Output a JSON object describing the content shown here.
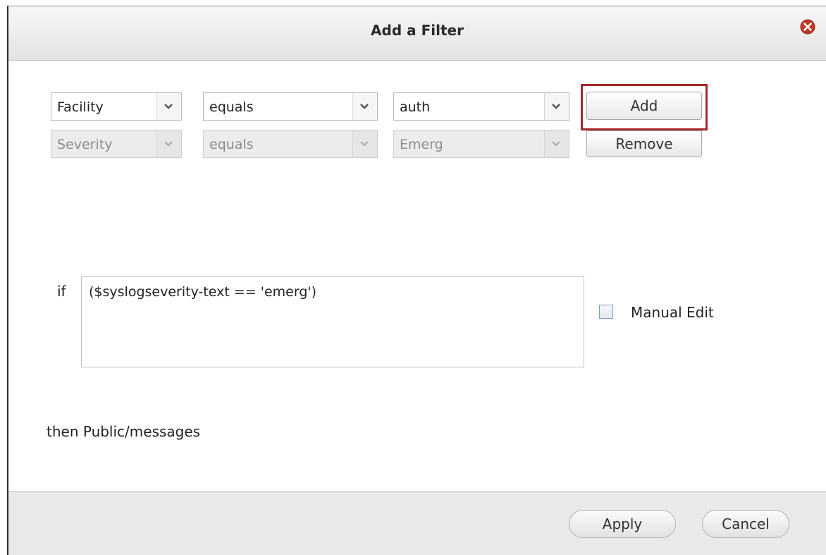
{
  "dialog": {
    "title": "Add a Filter"
  },
  "filter_rows": [
    {
      "field": "Facility",
      "operator": "equals",
      "value": "auth",
      "enabled": true
    },
    {
      "field": "Severity",
      "operator": "equals",
      "value": "Emerg",
      "enabled": false
    }
  ],
  "buttons": {
    "add_label": "Add",
    "remove_label": "Remove",
    "apply_label": "Apply",
    "cancel_label": "Cancel"
  },
  "condition": {
    "if_label": "if",
    "expression": "($syslogseverity-text == 'emerg')",
    "manual_edit_label": "Manual Edit",
    "manual_edit_checked": false
  },
  "action": {
    "then_text": "then Public/messages"
  },
  "colors": {
    "highlight": "#a3282f",
    "close_icon": "#c0392b"
  },
  "icons": {
    "close": "close-icon",
    "dropdown": "chevron-down-icon"
  }
}
